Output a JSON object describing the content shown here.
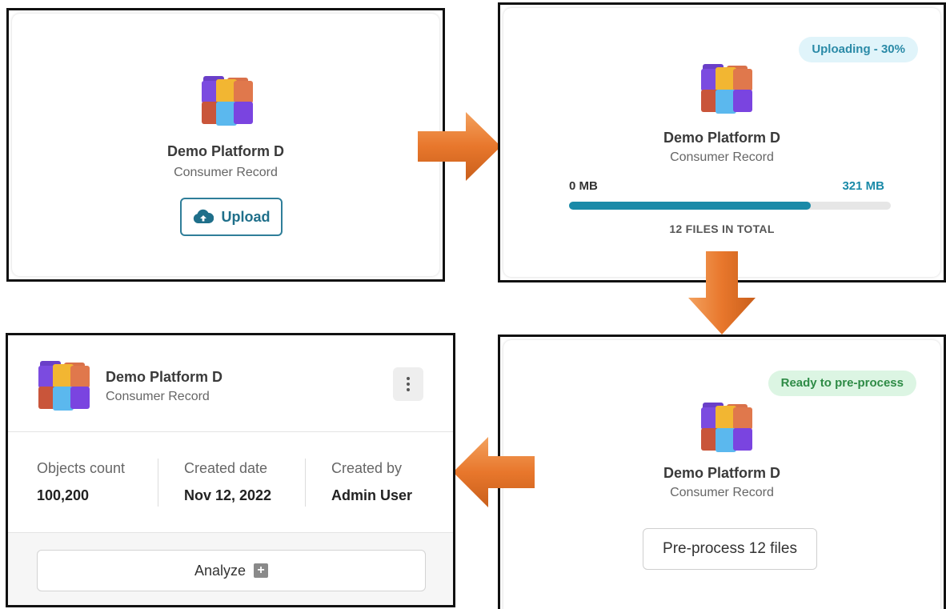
{
  "platform": {
    "name": "Demo Platform D",
    "record_type": "Consumer Record"
  },
  "step1": {
    "upload_label": "Upload",
    "upload_icon": "cloud-upload-icon"
  },
  "step2": {
    "status": "Uploading - 30%",
    "progress_start": "0 MB",
    "progress_end": "321 MB",
    "progress_fraction": 0.75,
    "files_total": "12 FILES IN TOTAL"
  },
  "step3": {
    "status": "Ready to pre-process",
    "button_label": "Pre-process 12 files"
  },
  "step4": {
    "stats": [
      {
        "label": "Objects count",
        "value": "100,200"
      },
      {
        "label": "Created date",
        "value": "Nov 12, 2022"
      },
      {
        "label": "Created by",
        "value": "Admin User"
      }
    ],
    "analyze_label": "Analyze",
    "menu_icon": "kebab-menu-icon"
  },
  "colors": {
    "arrow": "#e8772c",
    "accent": "#1a8aa8",
    "success": "#2e8b46"
  }
}
